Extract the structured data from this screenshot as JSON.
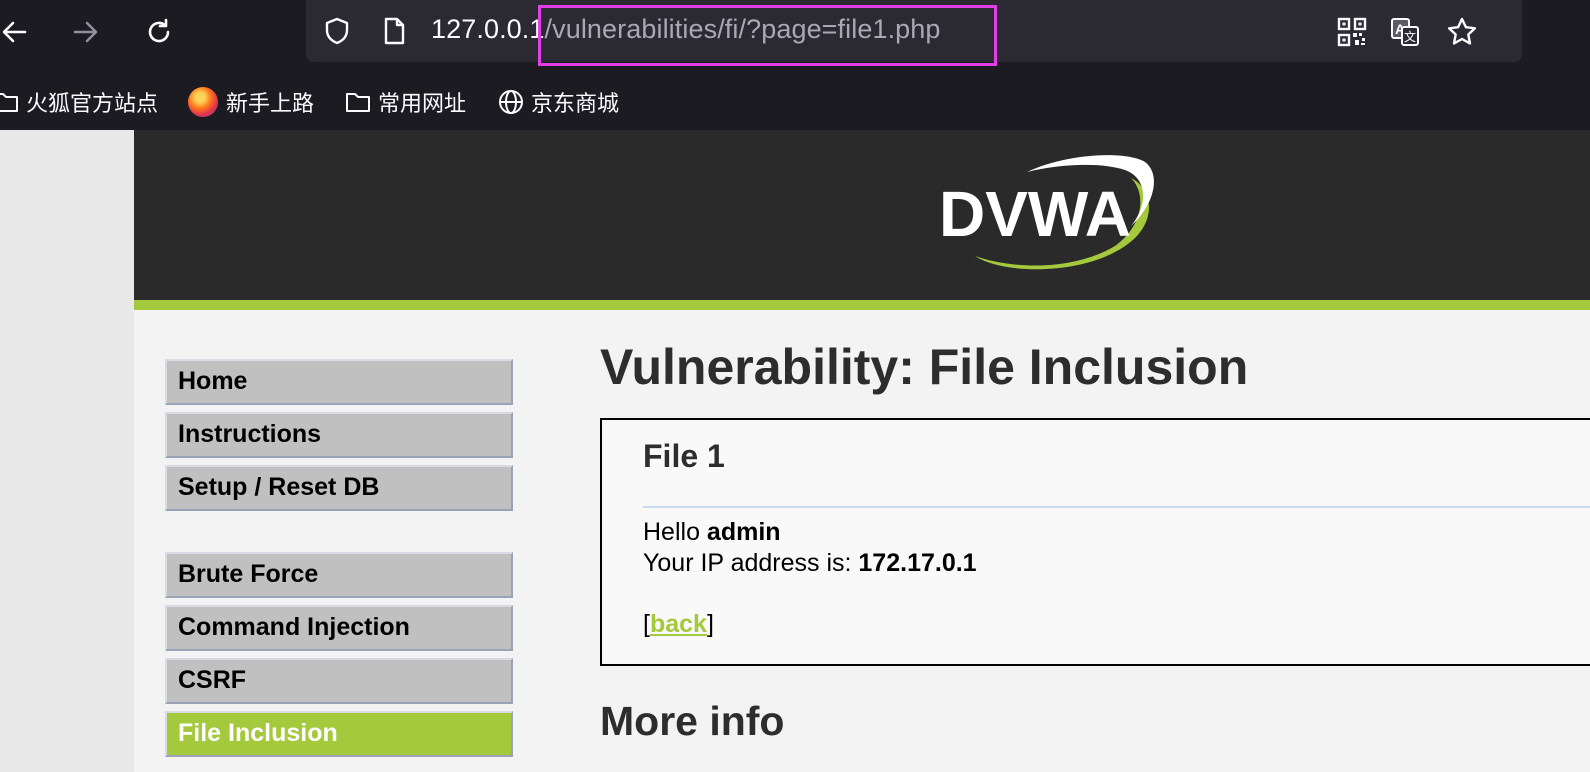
{
  "browser": {
    "url_host": "127.0.0.1",
    "url_path": "/vulnerabilities/fi/?page=file1.php",
    "bookmarks": [
      {
        "label": "火狐官方站点",
        "icon": "folder-icon"
      },
      {
        "label": "新手上路",
        "icon": "firefox-icon"
      },
      {
        "label": "常用网址",
        "icon": "folder-icon"
      },
      {
        "label": "京东商城",
        "icon": "globe-icon"
      }
    ]
  },
  "header": {
    "logo_text": "DVWA",
    "colors": {
      "header_bg": "#2a2a2a",
      "accent": "#a5c93d"
    }
  },
  "menu": {
    "items": [
      {
        "label": "Home"
      },
      {
        "label": "Instructions"
      },
      {
        "label": "Setup / Reset DB"
      },
      {
        "label": "Brute Force"
      },
      {
        "label": "Command Injection"
      },
      {
        "label": "CSRF"
      },
      {
        "label": "File Inclusion",
        "active": true
      }
    ]
  },
  "main": {
    "title": "Vulnerability: File Inclusion",
    "box": {
      "heading": "File 1",
      "hello_prefix": "Hello ",
      "hello_user": "admin",
      "ip_prefix": "Your IP address is: ",
      "ip_value": "172.17.0.1",
      "back_open": "[",
      "back_label": "back",
      "back_close": "]"
    },
    "more_info": "More info"
  }
}
